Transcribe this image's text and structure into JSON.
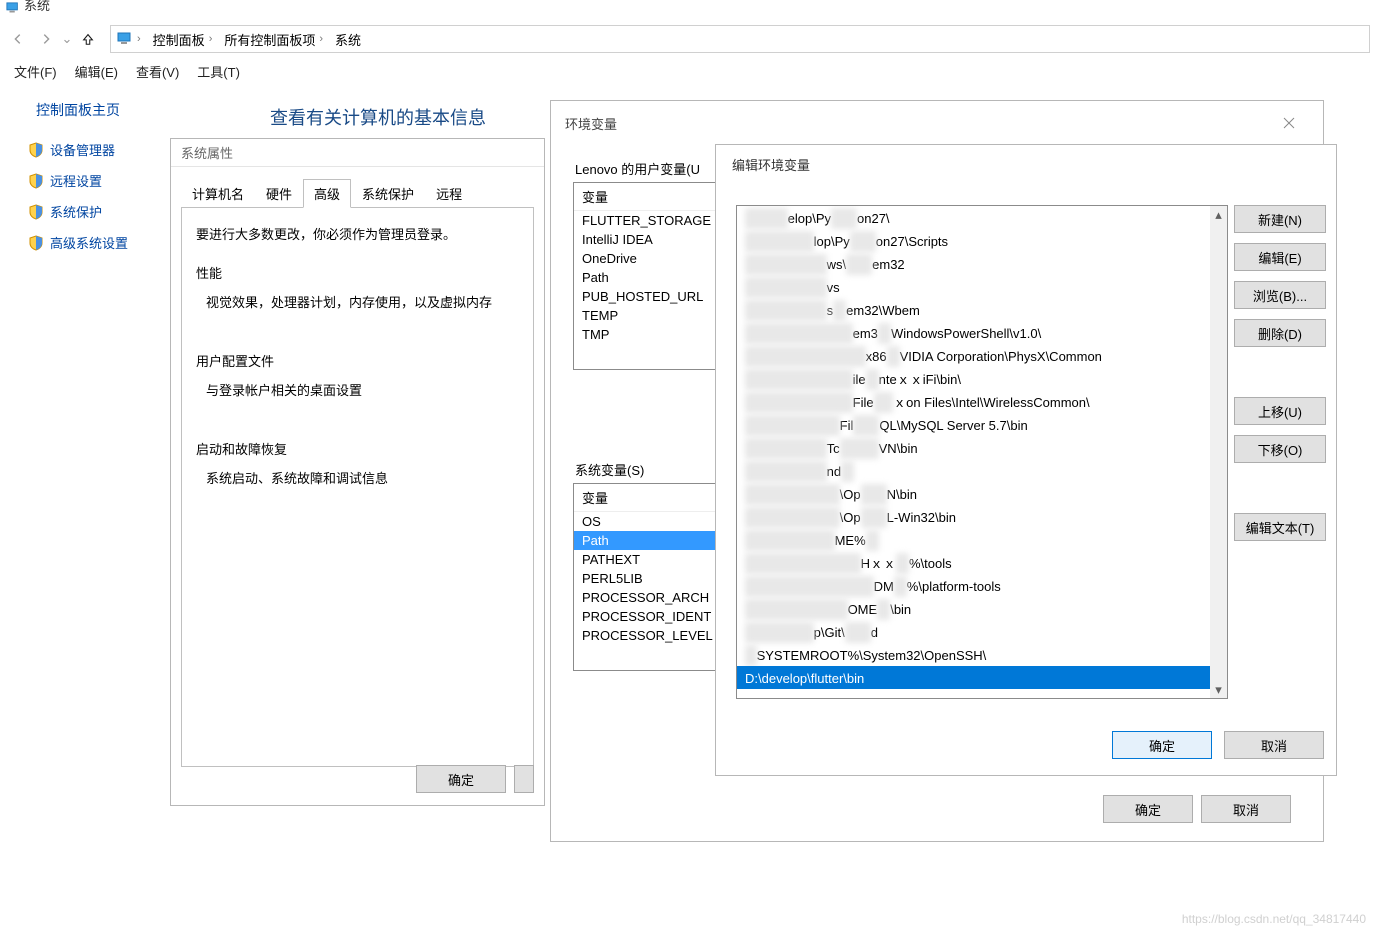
{
  "window_title": "系统",
  "breadcrumb": [
    "控制面板",
    "所有控制面板项",
    "系统"
  ],
  "menubar": [
    "文件(F)",
    "编辑(E)",
    "查看(V)",
    "工具(T)"
  ],
  "sidebar": {
    "header": "控制面板主页",
    "links": [
      "设备管理器",
      "远程设置",
      "系统保护",
      "高级系统设置"
    ]
  },
  "main_heading": "查看有关计算机的基本信息",
  "sysprops": {
    "title": "系统属性",
    "tabs": [
      "计算机名",
      "硬件",
      "高级",
      "系统保护",
      "远程"
    ],
    "active_tab": 2,
    "note": "要进行大多数更改，你必须作为管理员登录。",
    "sections": [
      {
        "label": "性能",
        "desc": "视觉效果，处理器计划，内存使用，以及虚拟内存"
      },
      {
        "label": "用户配置文件",
        "desc": "与登录帐户相关的桌面设置"
      },
      {
        "label": "启动和故障恢复",
        "desc": "系统启动、系统故障和调试信息"
      }
    ],
    "ok": "确定"
  },
  "envdlg": {
    "title": "环境变量",
    "user_label": "Lenovo 的用户变量(U",
    "user_var_hdr": "变量",
    "user_vars": [
      "FLUTTER_STORAGE",
      "IntelliJ IDEA",
      "OneDrive",
      "Path",
      "PUB_HOSTED_URL",
      "TEMP",
      "TMP"
    ],
    "sys_label": "系统变量(S)",
    "sys_var_hdr": "变量",
    "sys_vars": [
      "OS",
      "Path",
      "PATHEXT",
      "PERL5LIB",
      "PROCESSOR_ARCH",
      "PROCESSOR_IDENT",
      "PROCESSOR_LEVEL"
    ],
    "sys_selected": 1,
    "ok": "确定",
    "cancel": "取消"
  },
  "editdlg": {
    "title": "编辑环境变量",
    "entries": [
      {
        "mask": "D:\\ｘｘ",
        "text": "elop\\Py",
        "mask2": "ｘｘ",
        "text2": "on27\\"
      },
      {
        "mask": "D:\\ｘｘｘｘ",
        "text": "lop\\Py",
        "mask2": "ｘｘ",
        "text2": "on27\\Scripts"
      },
      {
        "mask": "C:\\ｘｘｘｘｘ",
        "text": "ws\\",
        "mask2": "ｘｘ",
        "text2": "em32"
      },
      {
        "mask": "C:\\ｘｘｘｘｘ",
        "text": "vs",
        "mask2": "",
        "text2": ""
      },
      {
        "mask": "C:\\ｘｘｘｘｘ",
        "text": "s",
        "mask2": "ｘ",
        "text2": "em32\\Wbem"
      },
      {
        "mask": "C:\\ｘｘｘｘｘｘｘ",
        "text": "em3",
        "mask2": "ｘ",
        "text2": "WindowsPowerShell\\v1.0\\"
      },
      {
        "mask": "C:\\ｘｘｘｘｘｘｘｘ",
        "text": "x86",
        "mask2": "ｘ",
        "text2": "VIDIA Corporation\\PhysX\\Common"
      },
      {
        "mask": "C:\\ｘｘｘｘｘｘｘ",
        "text": "ile",
        "mask2": "ｘ",
        "text2": "nteｘｘiFi\\bin\\"
      },
      {
        "mask": "C:\\ｘｘｘｘｘｘｘ",
        "text": "File",
        "mask2": "ｘc",
        "text2": "ｘon Files\\Intel\\WirelessCommon\\"
      },
      {
        "mask": "C:\\ｘｘｘｘｘｘ",
        "text": "Fil",
        "mask2": "ｘｘ",
        "text2": "QL\\MySQL Server 5.7\\bin"
      },
      {
        "mask": "C:\\ｘｘｘｘｘ",
        "text": "Tc",
        "mask2": "ｘｘｘ",
        "text2": "VN\\bin"
      },
      {
        "mask": "C:\\ｘｘｘｘｘ",
        "text": "nd",
        "mask2": "ｘ",
        "text2": ""
      },
      {
        "mask": "D:\\ｘｘｘｘｘｘ",
        "text": "\\Op",
        "mask2": "ｘｘ",
        "text2": "N\\bin"
      },
      {
        "mask": "D:\\ｘｘｘｘｘｘ",
        "text": "\\Op",
        "mask2": "ｘｘ",
        "text2": "L-Win32\\bin"
      },
      {
        "mask": "%ｘｘｘｘｘｘ",
        "text": "ME%",
        "mask2": "ｘ",
        "text2": ""
      },
      {
        "mask": "%ｘｘｘｘｘｘｘｘ",
        "text": "Hｘｘ",
        "mask2": "ｘ",
        "text2": "%\\tools"
      },
      {
        "mask": "%ｘｘｘｘｘｘｘｘｘ",
        "text": "DM",
        "mask2": "ｘ",
        "text2": "%\\platform-tools"
      },
      {
        "mask": "%ｘｘｘｘｘｘｘ",
        "text": "OME",
        "mask2": "ｘ",
        "text2": "\\bin"
      },
      {
        "mask": "D:\\ｘｘｘｘ",
        "text": "p\\Git\\",
        "mask2": "ｘｘ",
        "text2": "d"
      },
      {
        "mask": "%",
        "text": "SYSTEMROOT%\\System32\\OpenSSH\\",
        "mask2": "",
        "text2": ""
      }
    ],
    "selected_entry": "D:\\develop\\flutter\\bin",
    "buttons": {
      "new": "新建(N)",
      "edit": "编辑(E)",
      "browse": "浏览(B)...",
      "delete": "删除(D)",
      "moveup": "上移(U)",
      "movedown": "下移(O)",
      "edittext": "编辑文本(T)",
      "ok": "确定",
      "cancel": "取消"
    }
  },
  "watermark": "https://blog.csdn.net/qq_34817440"
}
